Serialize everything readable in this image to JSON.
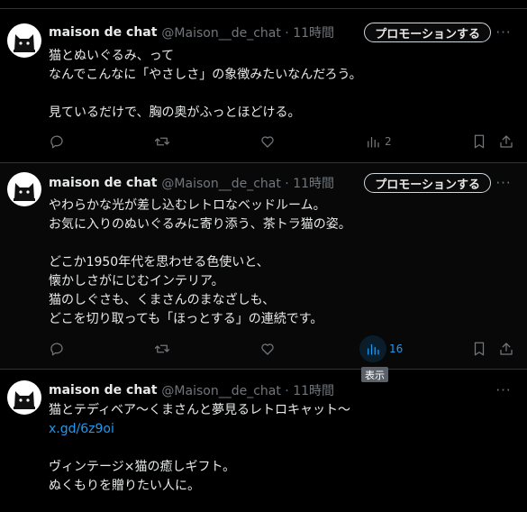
{
  "tweets": [
    {
      "username": "maison de chat",
      "handle": "@Maison__de_chat · 11時間",
      "promo_label": "プロモーションする",
      "more": "···",
      "lines": [
        "猫とぬいぐるみ、って",
        "なんでこんなに「やさしさ」の象徴みたいなんだろう。",
        "",
        "見ているだけで、胸の奥がふっとほどける。"
      ],
      "views": "2"
    },
    {
      "username": "maison de chat",
      "handle": "@Maison__de_chat · 11時間",
      "promo_label": "プロモーションする",
      "more": "···",
      "lines": [
        "やわらかな光が差し込むレトロなベッドルーム。",
        "お気に入りのぬいぐるみに寄り添う、茶トラ猫の姿。",
        "",
        "どこか1950年代を思わせる色使いと、",
        "懐かしさがにじむインテリア。",
        "猫のしぐさも、くまさんのまなざしも、",
        "どこを切り取っても「ほっとする」の連続です。"
      ],
      "views": "16",
      "tooltip": "表示"
    },
    {
      "username": "maison de chat",
      "handle": "@Maison__de_chat · 11時間",
      "more": "···",
      "lines": [
        "猫とテディベア〜くまさんと夢見るレトロキャット〜"
      ],
      "link": "x.gd/6z9oi",
      "lines2": [
        "",
        "ヴィンテージ×猫の癒しギフト。",
        "ぬくもりを贈りたい人に。"
      ]
    }
  ],
  "colors": {
    "accent": "#1d9bf0",
    "muted": "#71767b",
    "text": "#e7e9ea",
    "bg": "#000000"
  },
  "icons": [
    "reply-icon",
    "retweet-icon",
    "like-icon",
    "views-icon",
    "bookmark-icon",
    "share-icon",
    "more-icon"
  ]
}
